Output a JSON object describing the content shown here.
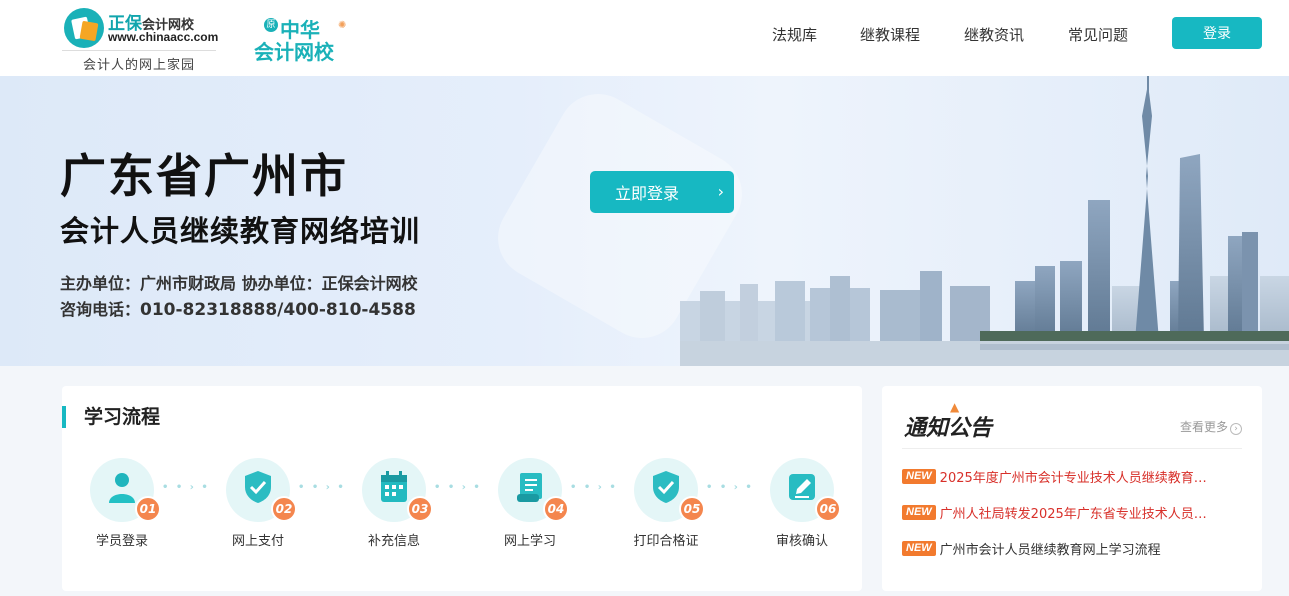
{
  "header": {
    "logo_brand": "正保",
    "logo_brand_suffix": "会计网校",
    "logo_url": "www.chinaacc.com",
    "logo_tagline": "会计人的网上家园",
    "logo2_seal": "原",
    "logo2_line1": "中华",
    "logo2_line2": "会计网校",
    "nav": [
      "法规库",
      "继教课程",
      "继教资讯",
      "常见问题"
    ],
    "login_label": "登录"
  },
  "banner": {
    "title": "广东省广州市",
    "subtitle": "会计人员继续教育网络培训",
    "organizer": "主办单位：广州市财政局   协办单位：正保会计网校",
    "phone_label": "咨询电话：",
    "phone_number": "010-82318888/400-810-4588",
    "cta_label": "立即登录"
  },
  "process": {
    "title": "学习流程",
    "steps": [
      {
        "num": "01",
        "label": "学员登录",
        "icon": "user-icon"
      },
      {
        "num": "02",
        "label": "网上支付",
        "icon": "shield-check-icon"
      },
      {
        "num": "03",
        "label": "补充信息",
        "icon": "calendar-icon"
      },
      {
        "num": "04",
        "label": "网上学习",
        "icon": "scroll-icon"
      },
      {
        "num": "05",
        "label": "打印合格证",
        "icon": "shield-check-icon"
      },
      {
        "num": "06",
        "label": "审核确认",
        "icon": "edit-icon"
      }
    ]
  },
  "notice": {
    "title": "通知公告",
    "more_label": "查看更多",
    "badge": "NEW",
    "items": [
      {
        "text": "2025年度广州市会计专业技术人员继续教育…",
        "color": "red"
      },
      {
        "text": "广州人社局转发2025年广东省专业技术人员…",
        "color": "red"
      },
      {
        "text": "广州市会计人员继续教育网上学习流程",
        "color": "dark"
      }
    ]
  },
  "colors": {
    "accent": "#17b8c2",
    "badge": "#f27a2e",
    "step_num": "#f4864e",
    "notice_red": "#d8302a"
  }
}
